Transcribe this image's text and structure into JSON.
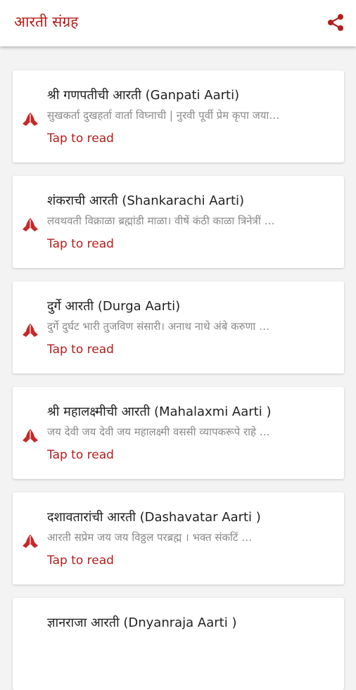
{
  "app": {
    "title": "आरती संग्रह",
    "accent_color": "#b71c1c",
    "share_icon": "share-icon"
  },
  "aartis": [
    {
      "title": "श्री गणपतीची आरती (Ganpati Aarti)",
      "snippet": "सुखकर्ता दुखहर्ता वार्ता विघ्नाची | नुरवी पूर्वी प्रेम कृपा जया…",
      "action": "Tap to read",
      "icon": "praying-hands-icon"
    },
    {
      "title": "शंकराची आरती  (Shankarachi Aarti)",
      "snippet": "लवथवती विक्राळा ब्रह्मांडी माळा।  वीषें कंठी काळा त्रिनेत्रीं …",
      "action": "Tap to read",
      "icon": "praying-hands-icon"
    },
    {
      "title": "दुर्गे आरती (Durga Aarti)",
      "snippet": "दुर्गे दुर्घट भारी तुजविण संसारी। अनाथ नाथे अंबे करुणा …",
      "action": "Tap to read",
      "icon": "praying-hands-icon"
    },
    {
      "title": "श्री महालक्ष्मीची आरती (Mahalaxmi Aarti )",
      "snippet": "जय देवी जय देवी जय महालक्ष्मी  वससी व्यापकरूपे राहे …",
      "action": "Tap to read",
      "icon": "praying-hands-icon"
    },
    {
      "title": "दशावतारांची आरती (Dashavatar Aarti )",
      "snippet": "आरती सप्रेम जय जय विठ्ठल परब्रह्म । भक्त संकटिं …",
      "action": "Tap to read",
      "icon": "praying-hands-icon"
    },
    {
      "title": "ज्ञानराजा आरती (Dnyanraja Aarti )",
      "snippet": "",
      "action": "",
      "icon": ""
    }
  ]
}
